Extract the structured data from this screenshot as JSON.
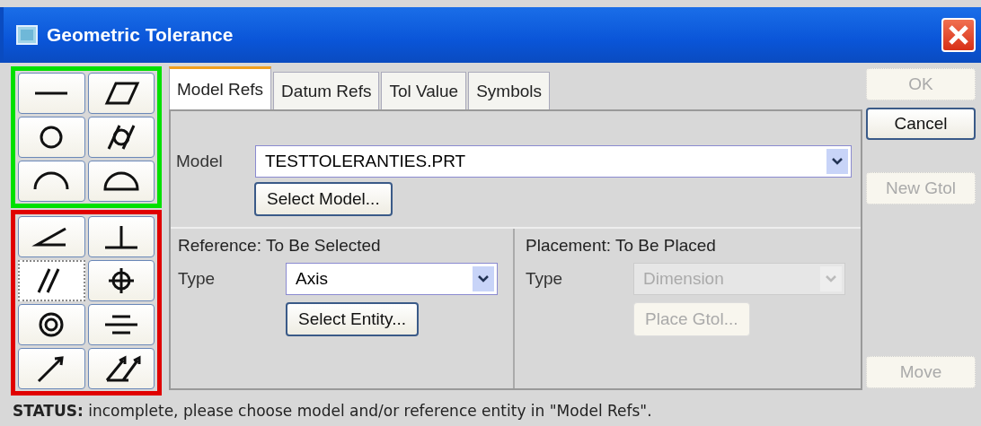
{
  "window": {
    "title": "Geometric Tolerance"
  },
  "symbol_groups": [
    {
      "color": "#00e000",
      "symbols": [
        {
          "kind": "straightness",
          "selected": false
        },
        {
          "kind": "flatness",
          "selected": false
        },
        {
          "kind": "circularity",
          "selected": false
        },
        {
          "kind": "cylindricity",
          "selected": false
        },
        {
          "kind": "line-profile",
          "selected": false
        },
        {
          "kind": "surface-profile",
          "selected": false
        }
      ]
    },
    {
      "color": "#e00000",
      "symbols": [
        {
          "kind": "angularity",
          "selected": false
        },
        {
          "kind": "perpendicularity",
          "selected": false
        },
        {
          "kind": "parallelism",
          "selected": true
        },
        {
          "kind": "position",
          "selected": false
        },
        {
          "kind": "concentricity",
          "selected": false
        },
        {
          "kind": "symmetry",
          "selected": false
        },
        {
          "kind": "circular-runout",
          "selected": false
        },
        {
          "kind": "total-runout",
          "selected": false
        }
      ]
    }
  ],
  "tabs": [
    {
      "label": "Model Refs",
      "selected": true
    },
    {
      "label": "Datum Refs",
      "selected": false
    },
    {
      "label": "Tol Value",
      "selected": false
    },
    {
      "label": "Symbols",
      "selected": false
    }
  ],
  "model": {
    "label": "Model",
    "value": "TESTTOLERANTIES.PRT",
    "button": "Select Model..."
  },
  "reference": {
    "label": "Reference:",
    "status": "To Be Selected",
    "type_label": "Type",
    "type_value": "Axis",
    "disabled": false,
    "button": "Select Entity..."
  },
  "placement": {
    "label": "Placement:",
    "status": "To Be Placed",
    "type_label": "Type",
    "type_value": "Dimension",
    "disabled": true,
    "button": "Place Gtol..."
  },
  "side_buttons": [
    {
      "label": "OK",
      "disabled": true
    },
    {
      "label": "Cancel",
      "disabled": false
    },
    {
      "label": "New Gtol",
      "disabled": true
    },
    {
      "label": "Move",
      "disabled": true
    }
  ],
  "status_bar": {
    "text": "**STATUS:** incomplete, please choose model and/or reference entity in \"Model Refs\"."
  }
}
